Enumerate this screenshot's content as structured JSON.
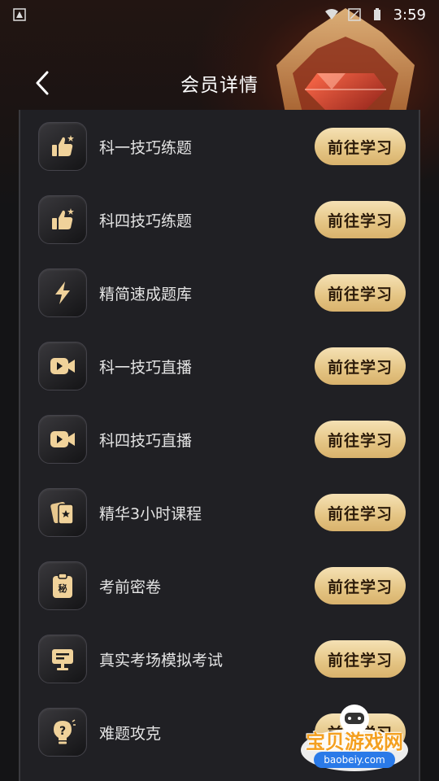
{
  "status_bar": {
    "time": "3:59"
  },
  "header": {
    "title": "会员详情"
  },
  "rows": [
    {
      "label": "科一技巧练题",
      "icon": "thumbs-up-icon",
      "button": "前往学习"
    },
    {
      "label": "科四技巧练题",
      "icon": "thumbs-up-icon",
      "button": "前往学习"
    },
    {
      "label": "精简速成题库",
      "icon": "lightning-icon",
      "button": "前往学习"
    },
    {
      "label": "科一技巧直播",
      "icon": "video-camera-icon",
      "button": "前往学习"
    },
    {
      "label": "科四技巧直播",
      "icon": "video-camera-icon",
      "button": "前往学习"
    },
    {
      "label": "精华3小时课程",
      "icon": "cards-icon",
      "button": "前往学习"
    },
    {
      "label": "考前密卷",
      "icon": "clipboard-icon",
      "button": "前往学习"
    },
    {
      "label": "真实考场模拟考试",
      "icon": "monitor-icon",
      "button": "前往学习"
    },
    {
      "label": "难题攻克",
      "icon": "lightbulb-question-icon",
      "button": "前往学习"
    }
  ],
  "watermark": {
    "text": "宝贝游戏网",
    "url": "baobeiy.com"
  },
  "colors": {
    "accent_gold": "#e4c483",
    "panel_bg": "#202024",
    "page_bg": "#141416",
    "icon_gold": "#f0d29a"
  }
}
